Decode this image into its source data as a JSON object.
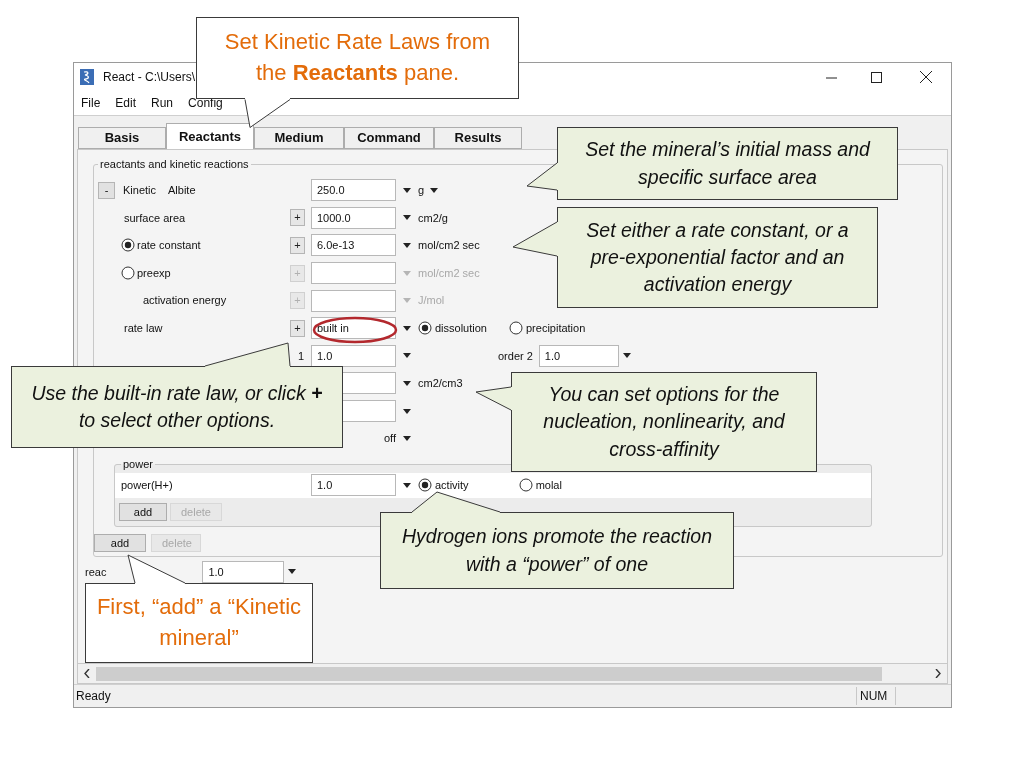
{
  "window": {
    "title": "React - C:\\Users\\"
  },
  "menu": [
    "File",
    "Edit",
    "Run",
    "Config"
  ],
  "tabs": [
    {
      "label": "Basis",
      "selected": false
    },
    {
      "label": "Reactants",
      "selected": true
    },
    {
      "label": "Medium",
      "selected": false
    },
    {
      "label": "Command",
      "selected": false
    },
    {
      "label": "Results",
      "selected": false
    }
  ],
  "group": {
    "title": "reactants and kinetic reactions",
    "reactant": {
      "toggle": "-",
      "type": "Kinetic",
      "name": "Albite",
      "amount": "250.0",
      "unit": "g"
    },
    "rows": [
      {
        "kind": "field",
        "label": "surface area",
        "button": "+",
        "value": "1000.0",
        "unit": "cm2/g",
        "disabled": false
      },
      {
        "kind": "radio",
        "label": "rate constant",
        "selected": true,
        "button": "+",
        "value": "6.0e-13",
        "unit": "mol/cm2 sec",
        "disabled": false
      },
      {
        "kind": "radio",
        "label": "preexp",
        "selected": false,
        "button": "+",
        "unit": "mol/cm2 sec",
        "disabled": true,
        "children": [
          {
            "kind": "field",
            "label": "activation energy",
            "button": "+",
            "unit": "J/mol",
            "disabled": true
          }
        ]
      },
      {
        "kind": "ratelaw",
        "label": "rate law",
        "button": "+",
        "value": "built in",
        "options": [
          {
            "label": "dissolution",
            "selected": true
          },
          {
            "label": "precipitation",
            "selected": false
          }
        ]
      },
      {
        "kind": "order",
        "label": "1",
        "value": "1.0",
        "label2": "order 2",
        "value2": "1.0"
      },
      {
        "kind": "field",
        "unit": "cm2/cm3",
        "disabled": false
      },
      {
        "kind": "field",
        "disabled": false
      },
      {
        "kind": "toggle",
        "value": "off"
      }
    ],
    "power": {
      "title": "power",
      "rows": [
        {
          "label": "power(H+)",
          "value": "1.0",
          "options": [
            {
              "label": "activity",
              "selected": true
            },
            {
              "label": "molal",
              "selected": false
            }
          ]
        }
      ],
      "buttons": [
        {
          "label": "add",
          "disabled": false
        },
        {
          "label": "delete",
          "disabled": true
        }
      ]
    },
    "buttons": [
      {
        "label": "add",
        "disabled": false
      },
      {
        "label": "delete",
        "disabled": true
      }
    ]
  },
  "extra_row": {
    "label": "reac",
    "value": "1.0"
  },
  "status_bar": {
    "text": "Ready",
    "indicator": "NUM"
  },
  "callouts": [
    {
      "kind": "title",
      "text": "Set Kinetic Rate Laws from the **Reactants** pane."
    },
    {
      "kind": "note",
      "text": "Set the mineral’s initial mass and specific surface area"
    },
    {
      "kind": "note",
      "text": "Set either a rate constant, or a pre-exponential factor and an activation energy"
    },
    {
      "kind": "note",
      "text": "Use the built-in rate law, or click **+** to select other options."
    },
    {
      "kind": "note",
      "text": "You can set options for the nucleation, nonlinearity, and cross-affinity"
    },
    {
      "kind": "note",
      "text": "Hydrogen ions promote the reaction with a “power” of one"
    },
    {
      "kind": "title",
      "text": "First, “add” a “Kinetic mineral”"
    }
  ]
}
